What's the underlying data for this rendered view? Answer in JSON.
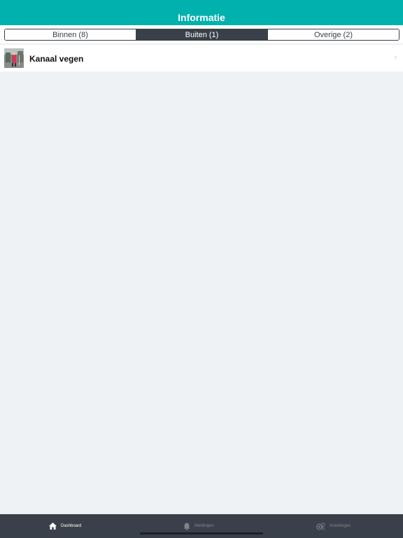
{
  "header": {
    "title": "Informatie"
  },
  "segments": [
    {
      "label": "Binnen (8)",
      "active": false
    },
    {
      "label": "Buiten (1)",
      "active": true
    },
    {
      "label": "Overige (2)",
      "active": false
    }
  ],
  "list": {
    "items": [
      {
        "title": "Kanaal vegen",
        "thumbnail": "outdoor-photo"
      }
    ]
  },
  "tabbar": {
    "items": [
      {
        "label": "Dashboard",
        "icon": "home-icon",
        "active": true
      },
      {
        "label": "Meldingen",
        "icon": "bell-icon",
        "active": false
      },
      {
        "label": "Instellingen",
        "icon": "gears-icon",
        "active": false
      }
    ]
  },
  "colors": {
    "accent": "#00b1ae",
    "dark": "#3a4049",
    "background": "#eef2f5"
  }
}
